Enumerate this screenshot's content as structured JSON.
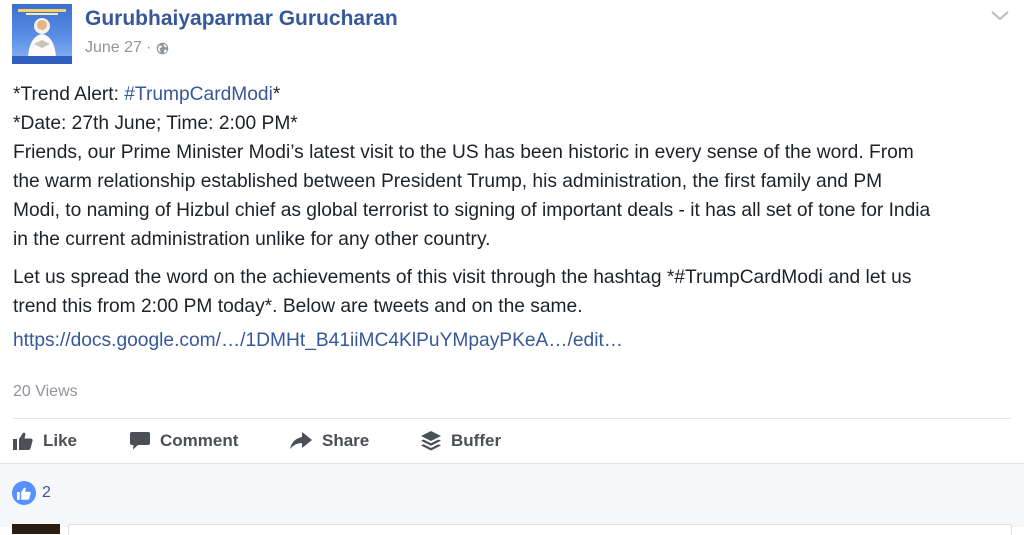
{
  "post": {
    "author": "Gurubhaiyaparmar Gurucharan",
    "date": "June 27",
    "separator": "·",
    "privacy_icon": "globe-icon",
    "menu_icon": "chevron-down-icon",
    "body": {
      "line1_prefix": "*Trend Alert: ",
      "line1_hashtag": "#TrumpCardModi",
      "line1_suffix": "*",
      "line2": "*Date: 27th June; Time: 2:00 PM*",
      "para1_lines": [
        "Friends, our Prime Minister Modi’s latest visit to the US has been historic in every sense of the word. From",
        "the warm relationship established between President Trump, his administration, the first family and PM",
        "Modi, to naming of Hizbul chief as global terrorist to signing of important deals - it has all set of tone for India",
        "in the current administration unlike for any other country."
      ],
      "para2_lines": [
        "Let us spread the word on the achievements of this visit through the hashtag *#TrumpCardModi and let us",
        "trend this from 2:00 PM today*. Below are tweets and on the same."
      ],
      "link": "https://docs.google.com/…/1DMHt_B41iiMC4KlPuYMpayPKeA…/edit…"
    },
    "views": "20 Views"
  },
  "actions": {
    "like": "Like",
    "comment": "Comment",
    "share": "Share",
    "buffer": "Buffer"
  },
  "reactions": {
    "count": "2"
  },
  "colors": {
    "link": "#365899",
    "meta": "#90949c",
    "action_text": "#4b4f56",
    "like_bubble": "#5890ff"
  }
}
